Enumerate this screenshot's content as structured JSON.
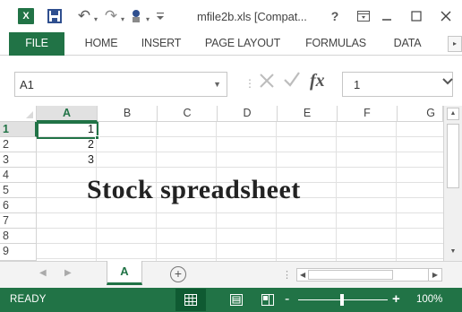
{
  "titlebar": {
    "app_logo": "X",
    "window_title": "mfile2b.xls  [Compat...",
    "help_label": "?",
    "icons": [
      "excel-logo-icon",
      "save-icon",
      "undo-icon",
      "redo-icon",
      "sort-icon",
      "help-icon",
      "ribbon-display-options-icon",
      "minimize-icon",
      "maximize-icon",
      "close-icon"
    ]
  },
  "ribbon": {
    "tabs": [
      "FILE",
      "HOME",
      "INSERT",
      "PAGE LAYOUT",
      "FORMULAS",
      "DATA"
    ],
    "scroll_right_glyph": "▸"
  },
  "formula_bar": {
    "name_box": "A1",
    "fx_label": "fx",
    "formula_value": "1"
  },
  "grid": {
    "columns": [
      "A",
      "B",
      "C",
      "D",
      "E",
      "F",
      "G"
    ],
    "rows": [
      "1",
      "2",
      "3",
      "4",
      "5",
      "6",
      "7",
      "8",
      "9"
    ],
    "selected_column": "A",
    "selected_row": "1",
    "cells": [
      {
        "ref": "A1",
        "value": "1"
      },
      {
        "ref": "A2",
        "value": "2"
      },
      {
        "ref": "A3",
        "value": "3"
      }
    ],
    "overlay_text": "Stock spreadsheet"
  },
  "sheets": {
    "tabs": [
      "A"
    ],
    "active": "A",
    "new_sheet_glyph": "+"
  },
  "statusbar": {
    "status": "READY",
    "zoom_minus": "-",
    "zoom_plus": "+",
    "zoom_label": "100%",
    "zoom_percent": 100
  },
  "colors": {
    "accent": "#217346",
    "header_selected": "#e1e1e1",
    "gridline": "#e1e1e1"
  }
}
